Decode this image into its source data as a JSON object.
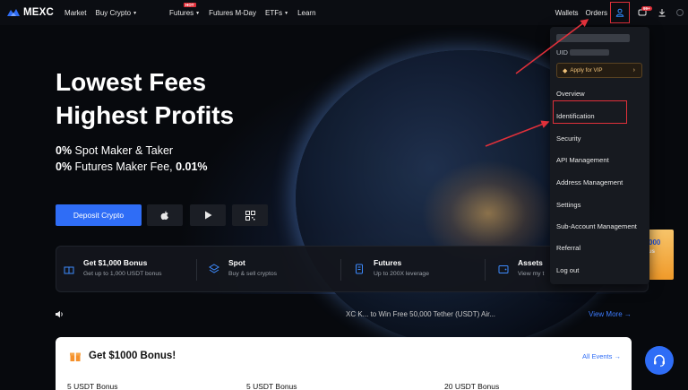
{
  "nav": {
    "logo": "MEXC",
    "items": [
      {
        "label": "Market",
        "caret": false
      },
      {
        "label": "Buy Crypto",
        "caret": true
      },
      {
        "label": "Futures",
        "caret": true,
        "badge": "HOT"
      },
      {
        "label": "Futures M-Day",
        "caret": false
      },
      {
        "label": "ETFs",
        "caret": true
      },
      {
        "label": "Learn",
        "caret": false
      }
    ],
    "wallets": "Wallets",
    "orders": "Orders",
    "notification_badge": "99+"
  },
  "hero": {
    "line1": "Lowest Fees",
    "line2": "Highest Profits",
    "sub1_bold": "0%",
    "sub1_rest": " Spot Maker & Taker",
    "sub2_bold": "0%",
    "sub2_mid": " Futures Maker Fee, ",
    "sub2_bold2": "0.01%",
    "deposit_label": "Deposit Crypto"
  },
  "features": [
    {
      "title": "Get $1,000 Bonus",
      "subtitle": "Get up to 1,000 USDT bonus",
      "icon": "gift-icon"
    },
    {
      "title": "Spot",
      "subtitle": "Buy & sell cryptos",
      "icon": "layers-icon"
    },
    {
      "title": "Futures",
      "subtitle": "Up to 200X leverage",
      "icon": "futures-icon"
    },
    {
      "title": "Assets",
      "subtitle": "View my t",
      "icon": "wallet-icon"
    }
  ],
  "ticker": {
    "text": "XC K... to Win Free 50,000 Tether (USDT) Air...",
    "more": "View More"
  },
  "bonus": {
    "title": "Get $1000 Bonus!",
    "all_events": "All Events",
    "items": [
      "5 USDT Bonus",
      "5 USDT Bonus",
      "20 USDT Bonus"
    ]
  },
  "dropdown": {
    "uid_label": "UID",
    "vip": "Apply for VIP",
    "items": [
      "Overview",
      "Identification",
      "Security",
      "API Management",
      "Address Management",
      "Settings",
      "Sub-Account Management",
      "Referral",
      "Log out"
    ]
  },
  "promo": {
    "line1": "000",
    "line2": "us"
  },
  "colors": {
    "accent": "#2f6df6",
    "highlight": "#e0303a",
    "vip_gold": "#f0c27a"
  }
}
